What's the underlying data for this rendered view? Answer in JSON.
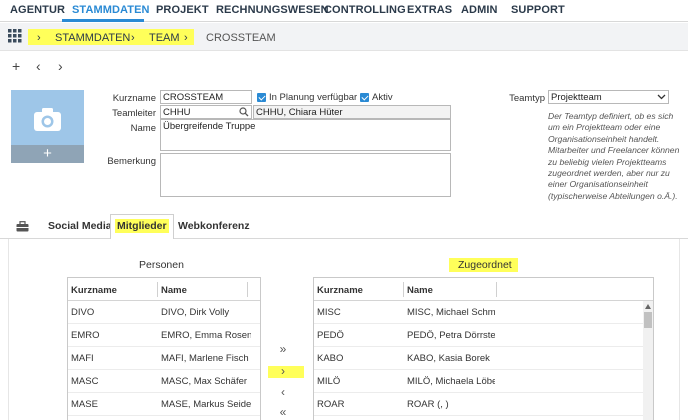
{
  "nav": {
    "items": [
      "AGENTUR",
      "STAMMDATEN",
      "PROJEKT",
      "RECHNUNGSWESEN",
      "CONTROLLING",
      "EXTRAS",
      "ADMIN",
      "SUPPORT"
    ]
  },
  "breadcrumb": {
    "items": [
      "STAMMDATEN",
      "TEAM",
      "CROSSTEAM"
    ]
  },
  "toolbar": {
    "add": "+",
    "prev": "‹",
    "next": "›"
  },
  "form": {
    "kurzname_label": "Kurzname",
    "kurzname": "CROSSTEAM",
    "in_planung_label": "In Planung verfügbar",
    "aktiv_label": "Aktiv",
    "teamleiter_label": "Teamleiter",
    "teamleiter": "CHHU",
    "teamleiter_name": "CHHU, Chiara Hüter",
    "name_label": "Name",
    "name": "Übergreifende Truppe",
    "bemerkung_label": "Bemerkung",
    "bemerkung": "",
    "teamtyp_label": "Teamtyp",
    "teamtyp": "Projektteam",
    "help_text": "Der Teamtyp definiert, ob es sich um ein Projektteam oder eine Organisationseinheit handelt. Mitarbeiter und Freelancer können zu beliebig vielen Projektteams zugeordnet werden, aber nur zu einer Organisationseinheit (typischerweise Abteilungen o.Ä.)."
  },
  "tabs": [
    "Social Media",
    "Mitglieder",
    "Webkonferenz"
  ],
  "personen": {
    "title": "Personen",
    "headers": [
      "Kurzname",
      "Name"
    ],
    "rows": [
      [
        "DIVO",
        "DIVO, Dirk Volly"
      ],
      [
        "EMRO",
        "EMRO, Emma Rosent..."
      ],
      [
        "MAFI",
        "MAFI, Marlene Fisch"
      ],
      [
        "MASC",
        "MASC, Max Schäfer"
      ],
      [
        "MASE",
        "MASE, Markus Seidel"
      ]
    ]
  },
  "zugeordnet": {
    "title": "Zugeordnet",
    "headers": [
      "Kurzname",
      "Name"
    ],
    "rows": [
      [
        "MISC",
        "MISC, Michael Schmi..."
      ],
      [
        "PEDÖ",
        "PEDÖ, Petra Dörrstein"
      ],
      [
        "KABO",
        "KABO, Kasia Borek"
      ],
      [
        "MILÖ",
        "MILÖ, Michaela Löber"
      ],
      [
        "ROAR",
        "ROAR (, )"
      ]
    ]
  },
  "transfer": {
    "all_right": "»",
    "right": "›",
    "left": "‹",
    "all_left": "«"
  },
  "colors": {
    "accent": "#2a8ad4",
    "highlight": "#ffff5a"
  }
}
